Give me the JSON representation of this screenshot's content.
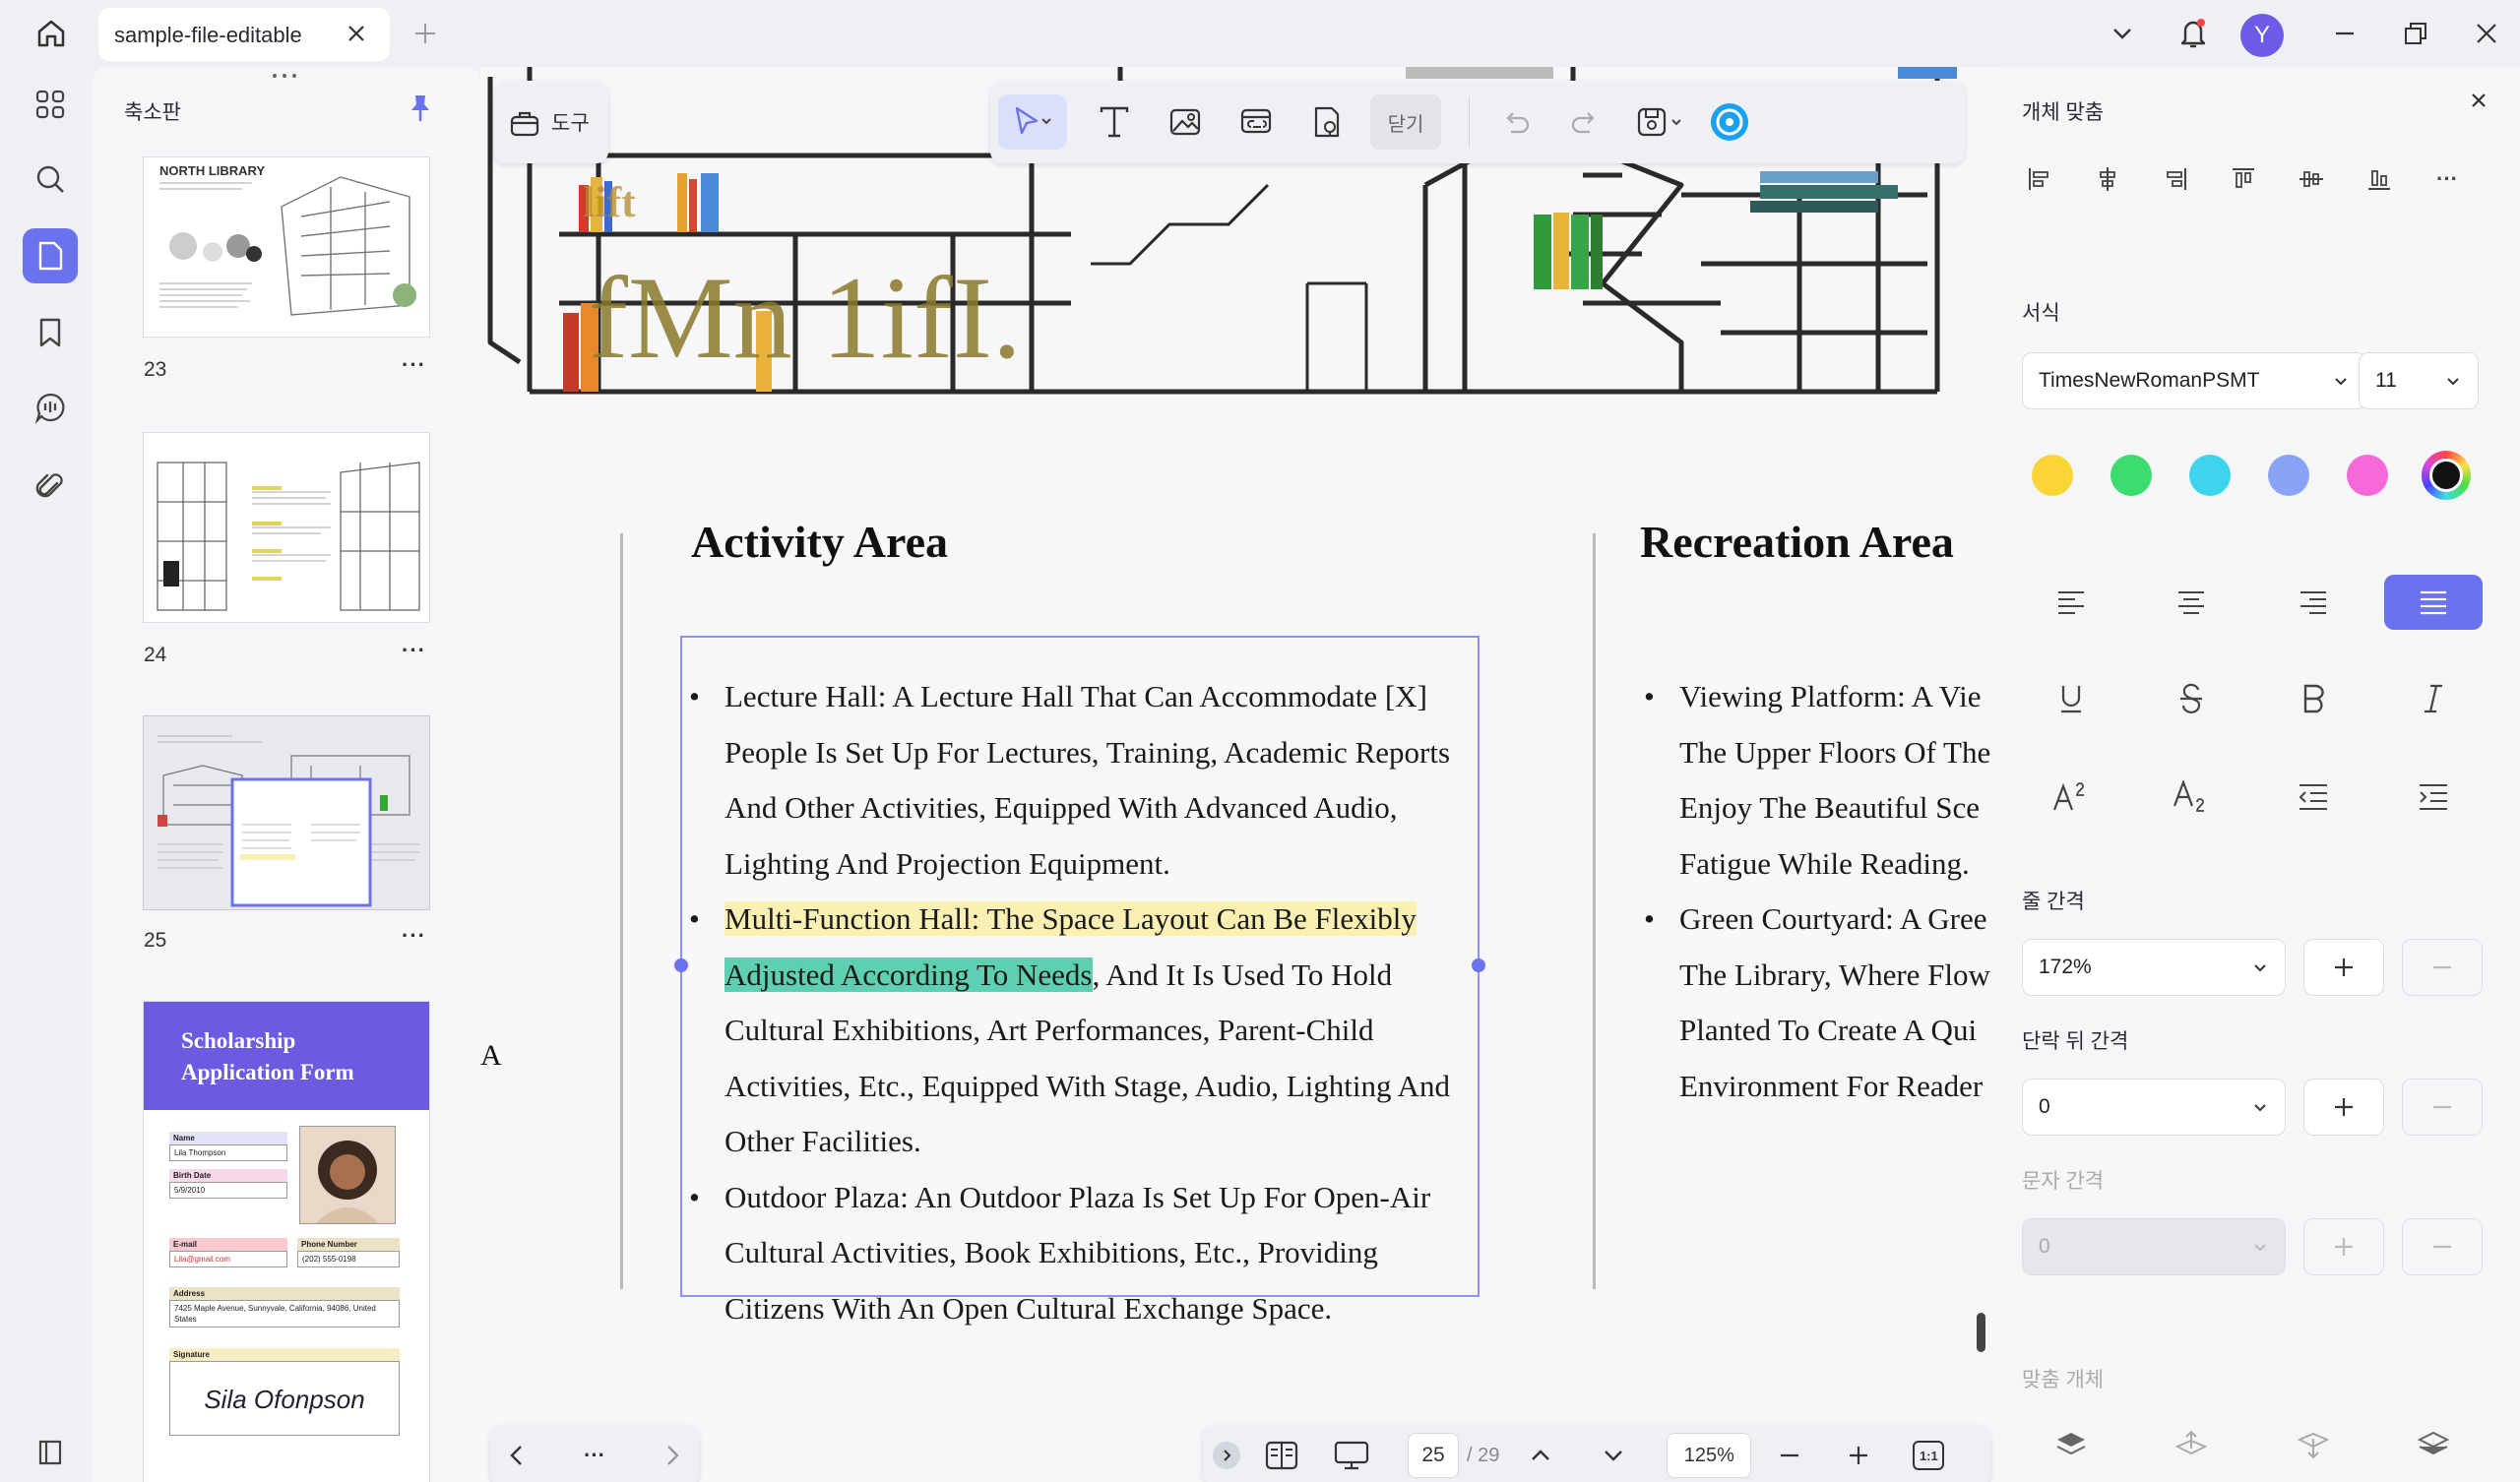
{
  "app": {
    "tab_title": "sample-file-editable",
    "avatar_letter": "Y"
  },
  "thumbnails": {
    "panel_title": "축소판",
    "pages": [
      {
        "number": "23",
        "heading": "NORTH LIBRARY"
      },
      {
        "number": "24"
      },
      {
        "number": "25"
      }
    ],
    "more": "···",
    "form_preview": {
      "title_line1": "Scholarship",
      "title_line2": "Application Form",
      "name_label": "Name",
      "name_value": "Lila Thompson",
      "birth_label": "Birth Date",
      "birth_value": "5/9/2010",
      "email_label": "E-mail",
      "email_value": "Lila@gmail.com",
      "phone_label": "Phone Number",
      "phone_value": "(202) 555-0198",
      "address_label": "Address",
      "address_value": "7425 Maple Avenue, Sunnyvale, California, 94086, United States",
      "signature_label": "Signature",
      "signature_value": "Sila Ofonpson"
    }
  },
  "toolbar": {
    "tools_label": "도구",
    "close_label": "닫기"
  },
  "document": {
    "image_text": "fMn 1ifI.",
    "image_small_text": "lift",
    "activity": {
      "heading": "Activity Area",
      "b1": "Lecture Hall: A Lecture Hall That Can Accommodate [X] People Is Set Up For Lectures, Training, Academic Reports And Other Activities, Equipped With Advanced Audio, Lighting And Projection Equipment.",
      "b2_highlight": "Multi-Function Hall: The Space Layout Can Be Flexibly ",
      "b2_green": "Adjusted According To Needs",
      "b2_rest": ", And It Is Used To Hold Cultural Exhibitions, Art Performances, Parent-Child Activities, Etc., Equipped With Stage, Audio, Lighting And Other Facilities.",
      "b3": "Outdoor Plaza: An Outdoor Plaza Is Set Up For Open-Air Cultural Activities, Book Exhibitions, Etc., Providing Citizens With An Open Cultural Exchange Space."
    },
    "recreation": {
      "heading": "Recreation Area",
      "b1_lines": [
        "Viewing Platform: A Vie",
        "The Upper Floors Of The",
        "Enjoy The Beautiful Sce",
        "Fatigue While Reading."
      ],
      "b2_lines": [
        "Green Courtyard: A Gree",
        "The Library, Where Flow",
        "Planted To Create A Qui",
        "Environment For Reader"
      ]
    },
    "left_edge_glyph": "A"
  },
  "bottombar": {
    "more": "···",
    "page_current": "25",
    "page_total": "/ 29",
    "zoom": "125%",
    "fit_label": "1:1"
  },
  "properties": {
    "title": "개체 맞춤",
    "format_label": "서식",
    "font_family": "TimesNewRomanPSMT",
    "font_size": "11",
    "colors": [
      "#fbd535",
      "#3ddc6e",
      "#3fd4ee",
      "#8aa4f5",
      "#f56ad8",
      "#111111"
    ],
    "line_spacing_label": "줄 간격",
    "line_spacing_value": "172%",
    "para_spacing_label": "단락 뒤 간격",
    "para_spacing_value": "0",
    "char_spacing_label": "문자 간격",
    "char_spacing_value": "0",
    "arrange_label": "맞춤 개체",
    "accent": "#6a72ee"
  }
}
